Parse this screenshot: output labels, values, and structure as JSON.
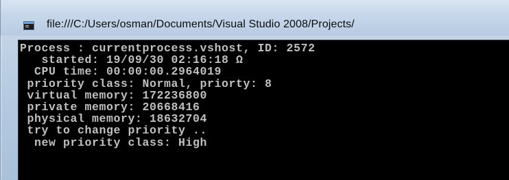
{
  "window": {
    "title": "file:///C:/Users/osman/Documents/Visual Studio 2008/Projects/",
    "icon": "console-window-icon"
  },
  "console": {
    "background": "#000000",
    "foreground": "#c0c0c0",
    "lines": [
      "Process : currentprocess.vshost, ID: 2572",
      "   started: 19/09/30 02:16:18 Ω",
      "  CPU time: 00:00:00.2964019",
      " priority class: Normal, priorty: 8",
      " virtual memory: 172236800",
      " private memory: 20668416",
      " physical memory: 18632704",
      " try to change priority ..",
      "  new priority class: High"
    ]
  }
}
